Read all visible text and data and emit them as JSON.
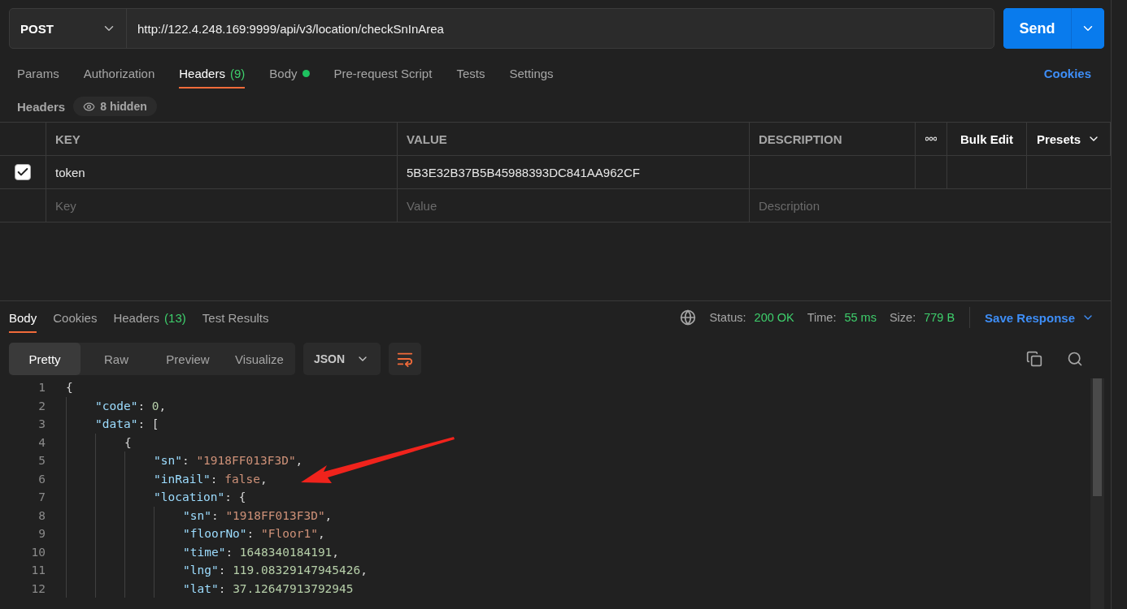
{
  "request": {
    "method": "POST",
    "url": "http://122.4.248.169:9999/api/v3/location/checkSnInArea",
    "send": "Send"
  },
  "request_tabs": [
    {
      "label": "Params",
      "selected": false
    },
    {
      "label": "Authorization",
      "selected": false
    },
    {
      "label": "Headers",
      "count": "(9)",
      "selected": true
    },
    {
      "label": "Body",
      "has_content": true,
      "selected": false
    },
    {
      "label": "Pre-request Script",
      "selected": false
    },
    {
      "label": "Tests",
      "selected": false
    },
    {
      "label": "Settings",
      "selected": false
    }
  ],
  "cookies_link": "Cookies",
  "headers_bar": {
    "title": "Headers",
    "hidden": "8 hidden"
  },
  "headers_table": {
    "columns": [
      "KEY",
      "VALUE",
      "DESCRIPTION"
    ],
    "actions": [
      "Bulk Edit",
      "Presets"
    ],
    "rows": [
      {
        "checked": true,
        "key": "token",
        "value": "5B3E32B37B5B45988393DC841AA962CF"
      }
    ],
    "new_row": {
      "key_placeholder": "Key",
      "value_placeholder": "Value",
      "description_placeholder": "Description"
    }
  },
  "response": {
    "tabs": [
      {
        "label": "Body",
        "selected": true
      },
      {
        "label": "Cookies",
        "selected": false
      },
      {
        "label": "Headers",
        "count": "(13)",
        "selected": false
      },
      {
        "label": "Test Results",
        "selected": false
      }
    ],
    "stats": [
      {
        "label": "Status:",
        "value": "200 OK"
      },
      {
        "label": "Time:",
        "value": "55 ms"
      },
      {
        "label": "Size:",
        "value": "779 B"
      }
    ],
    "save": "Save Response",
    "view_modes": [
      {
        "label": "Pretty",
        "selected": true
      },
      {
        "label": "Raw",
        "selected": false
      },
      {
        "label": "Preview",
        "selected": false
      },
      {
        "label": "Visualize",
        "selected": false
      }
    ],
    "format": "JSON",
    "code": [
      {
        "number": "1",
        "tokens": [
          {
            "kind": "punct",
            "text": "{"
          }
        ],
        "children": [
          {
            "number": "2",
            "tokens": [
              {
                "kind": "key",
                "text": "\"code\""
              },
              {
                "kind": "punct",
                "text": ": "
              },
              {
                "kind": "number",
                "text": "0"
              },
              {
                "kind": "punct",
                "text": ","
              }
            ]
          },
          {
            "number": "3",
            "tokens": [
              {
                "kind": "key",
                "text": "\"data\""
              },
              {
                "kind": "punct",
                "text": ": ["
              }
            ],
            "children": [
              {
                "number": "4",
                "tokens": [
                  {
                    "kind": "punct",
                    "text": "{"
                  }
                ],
                "children": [
                  {
                    "number": "5",
                    "tokens": [
                      {
                        "kind": "key",
                        "text": "\"sn\""
                      },
                      {
                        "kind": "punct",
                        "text": ": "
                      },
                      {
                        "kind": "string",
                        "text": "\"1918FF013F3D\""
                      },
                      {
                        "kind": "punct",
                        "text": ","
                      }
                    ]
                  },
                  {
                    "number": "6",
                    "tokens": [
                      {
                        "kind": "key",
                        "text": "\"inRail\""
                      },
                      {
                        "kind": "punct",
                        "text": ": "
                      },
                      {
                        "kind": "literal",
                        "text": "false"
                      },
                      {
                        "kind": "punct",
                        "text": ","
                      }
                    ]
                  },
                  {
                    "number": "7",
                    "tokens": [
                      {
                        "kind": "key",
                        "text": "\"location\""
                      },
                      {
                        "kind": "punct",
                        "text": ": {"
                      }
                    ],
                    "children": [
                      {
                        "number": "8",
                        "tokens": [
                          {
                            "kind": "key",
                            "text": "\"sn\""
                          },
                          {
                            "kind": "punct",
                            "text": ": "
                          },
                          {
                            "kind": "string",
                            "text": "\"1918FF013F3D\""
                          },
                          {
                            "kind": "punct",
                            "text": ","
                          }
                        ]
                      },
                      {
                        "number": "9",
                        "tokens": [
                          {
                            "kind": "key",
                            "text": "\"floorNo\""
                          },
                          {
                            "kind": "punct",
                            "text": ": "
                          },
                          {
                            "kind": "string",
                            "text": "\"Floor1\""
                          },
                          {
                            "kind": "punct",
                            "text": ","
                          }
                        ]
                      },
                      {
                        "number": "10",
                        "tokens": [
                          {
                            "kind": "key",
                            "text": "\"time\""
                          },
                          {
                            "kind": "punct",
                            "text": ": "
                          },
                          {
                            "kind": "number",
                            "text": "1648340184191"
                          },
                          {
                            "kind": "punct",
                            "text": ","
                          }
                        ]
                      },
                      {
                        "number": "11",
                        "tokens": [
                          {
                            "kind": "key",
                            "text": "\"lng\""
                          },
                          {
                            "kind": "punct",
                            "text": ": "
                          },
                          {
                            "kind": "number",
                            "text": "119.08329147945426"
                          },
                          {
                            "kind": "punct",
                            "text": ","
                          }
                        ]
                      },
                      {
                        "number": "12",
                        "tokens": [
                          {
                            "kind": "key",
                            "text": "\"lat\""
                          },
                          {
                            "kind": "punct",
                            "text": ": "
                          },
                          {
                            "kind": "number",
                            "text": "37.12647913792945"
                          }
                        ]
                      }
                    ]
                  }
                ]
              }
            ]
          }
        ]
      }
    ]
  }
}
